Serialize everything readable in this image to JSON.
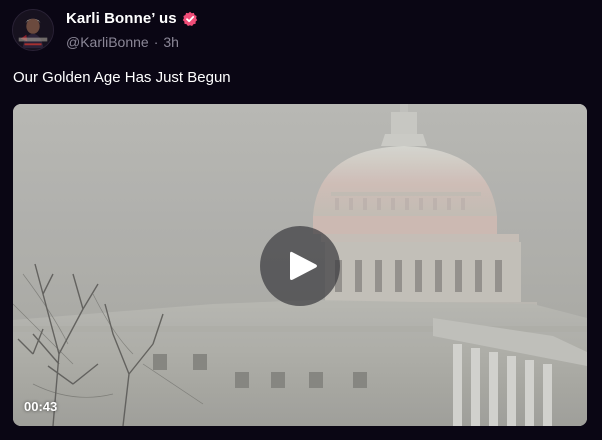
{
  "author": {
    "display_name": "Karli Bonne’ us",
    "handle": "@KarliBonne",
    "separator": "·",
    "time": "3h",
    "verified": true,
    "verified_color": "#f04d78"
  },
  "post": {
    "text": "Our Golden Age Has Just Begun"
  },
  "video": {
    "duration": "00:43",
    "play_icon": "play-icon"
  },
  "colors": {
    "background": "#0a0614",
    "text_primary": "#ffffff",
    "text_secondary": "#8b8797"
  }
}
